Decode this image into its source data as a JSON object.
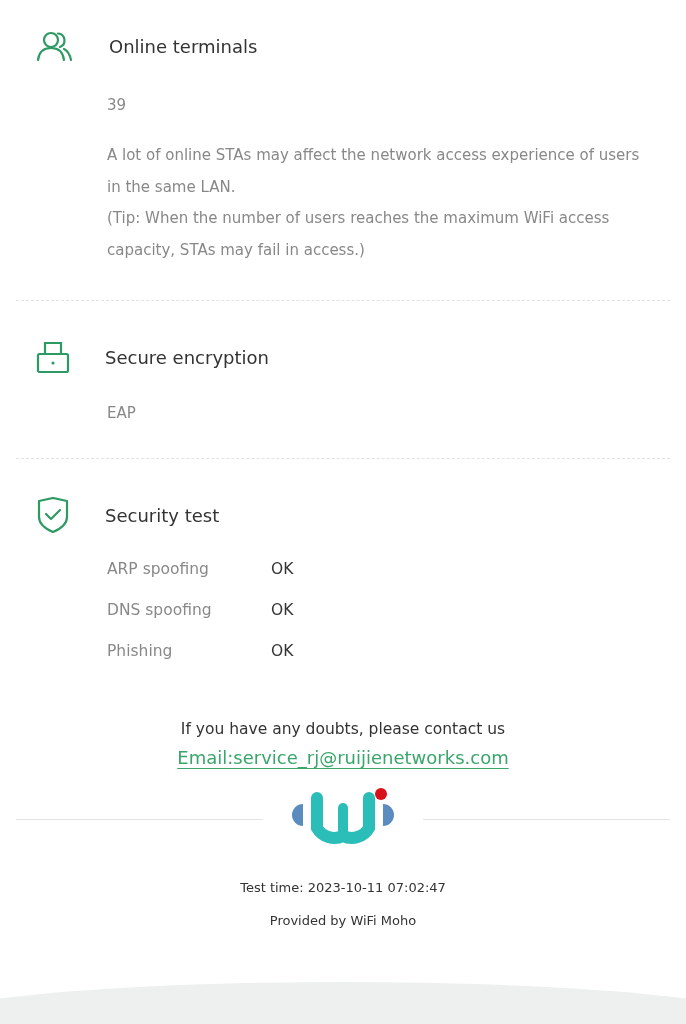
{
  "sections": [
    {
      "kind": "users",
      "title": "Online terminals",
      "value": "39",
      "notes": [
        "A lot of online STAs may affect the network access experience of users in the same LAN.",
        "(Tip: When the number of users reaches the maximum WiFi access capacity, STAs may fail in access.)"
      ]
    },
    {
      "kind": "lock",
      "title": "Secure encryption",
      "value": "EAP"
    },
    {
      "kind": "shield",
      "title": "Security test",
      "checks": [
        {
          "name": "ARP spoofing",
          "result": "OK"
        },
        {
          "name": "DNS spoofing",
          "result": "OK"
        },
        {
          "name": "Phishing",
          "result": "OK"
        }
      ]
    }
  ],
  "contact": {
    "prompt": "If you have any doubts, please contact us",
    "email": "Email:service_rj@ruijienetworks.com"
  },
  "footer": {
    "test_time": "Test time: 2023-10-11 07:02:47",
    "provider": "Provided by WiFi Moho"
  }
}
